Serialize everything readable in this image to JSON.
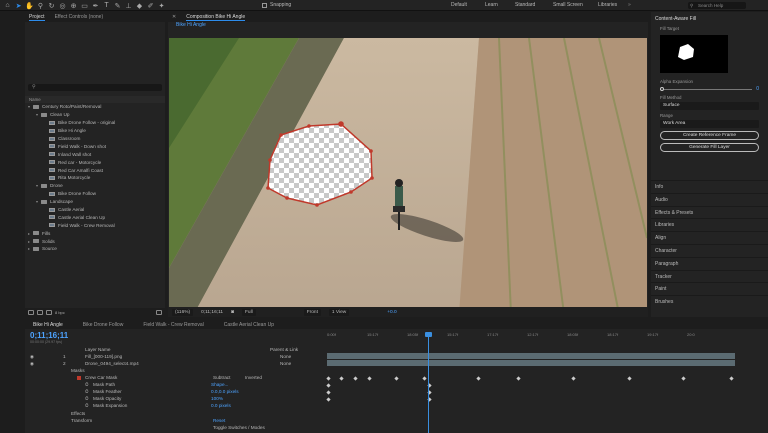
{
  "toolbar": {
    "snapping_label": "Snapping",
    "workspaces": [
      "Default",
      "Learn",
      "Standard",
      "Small Screen",
      "Libraries"
    ],
    "search_placeholder": "Search Help"
  },
  "project_panel": {
    "tabs": [
      "Project",
      "Effect Controls (none)"
    ],
    "column_header": "Name",
    "bpc": "8 bpc",
    "tree": [
      {
        "label": "Century Roto/Paint/Removal",
        "depth": 0,
        "kind": "folder",
        "open": true
      },
      {
        "label": "Clean Up",
        "depth": 1,
        "kind": "folder",
        "open": true
      },
      {
        "label": "Bike Drone Follow - original",
        "depth": 2,
        "kind": "comp"
      },
      {
        "label": "Bike Hi Angle",
        "depth": 2,
        "kind": "comp"
      },
      {
        "label": "Classroom",
        "depth": 2,
        "kind": "comp"
      },
      {
        "label": "Field Walk - Down shot",
        "depth": 2,
        "kind": "comp"
      },
      {
        "label": "Inland Wall shot",
        "depth": 2,
        "kind": "comp"
      },
      {
        "label": "Red car - Motorcycle",
        "depth": 2,
        "kind": "comp"
      },
      {
        "label": "Red Car Amalfi Coast",
        "depth": 2,
        "kind": "comp"
      },
      {
        "label": "Rita Motorcycle",
        "depth": 2,
        "kind": "comp"
      },
      {
        "label": "Drone",
        "depth": 1,
        "kind": "folder",
        "open": true
      },
      {
        "label": "Bike Drone Follow",
        "depth": 2,
        "kind": "comp"
      },
      {
        "label": "Landscape",
        "depth": 1,
        "kind": "folder",
        "open": true
      },
      {
        "label": "Castle Aerial",
        "depth": 2,
        "kind": "comp"
      },
      {
        "label": "Castle Aerial Clean Up",
        "depth": 2,
        "kind": "comp"
      },
      {
        "label": "Field Walk - Crew Removal",
        "depth": 2,
        "kind": "comp"
      },
      {
        "label": "Fills",
        "depth": 0,
        "kind": "folder",
        "open": false
      },
      {
        "label": "Solids",
        "depth": 0,
        "kind": "folder",
        "open": false
      },
      {
        "label": "Source",
        "depth": 0,
        "kind": "folder",
        "open": false
      }
    ]
  },
  "composition": {
    "tab_label": "Composition Bike Hi Angle",
    "sub_tab": "Bike Hi Angle",
    "footer": {
      "zoom": "(116%)",
      "timecode": "0;11;16;11",
      "resolution": "Full",
      "view": "Front",
      "views_count": "1 View",
      "exposure": "+0.0"
    }
  },
  "content_aware_fill": {
    "title": "Content-Aware Fill",
    "fill_target_label": "Fill Target",
    "alpha_expansion_label": "Alpha Expansion",
    "alpha_expansion_value": "0",
    "fill_method_label": "Fill Method",
    "fill_method_value": "Surface",
    "range_label": "Range",
    "range_value": "Work Area",
    "create_reference_frame": "Create Reference Frame",
    "generate_fill_layer": "Generate Fill Layer"
  },
  "right_panels": [
    "Info",
    "Audio",
    "Effects & Presets",
    "Libraries",
    "Align",
    "Character",
    "Paragraph",
    "Tracker",
    "Paint",
    "Brushes"
  ],
  "timeline": {
    "tabs": [
      "Bike Hi Angle",
      "Bike Drone Follow",
      "Field Walk - Crew Removal",
      "Castle Aerial Clean Up"
    ],
    "timecode": "0;11;16;11",
    "fps": "00:00:00 (29.97 fps)",
    "column_layer_name": "Layer Name",
    "column_parent": "Parent & Link",
    "ruler_ticks": [
      "0:00f",
      "15:17f",
      "18:05f",
      "15:17f",
      "17:17f",
      "12:17f",
      "18:05f",
      "18:17f",
      "19:17f",
      "20:0"
    ],
    "layers": [
      {
        "num": "1",
        "name": "Fill_[000-119].png",
        "parent": "None"
      },
      {
        "num": "2",
        "name": "Drone_0494_select4.mp4",
        "parent": "None"
      }
    ],
    "masks_label": "Masks",
    "mask_name": "Crew Car Mask",
    "mask_mode": "Subtract",
    "inverted_label": "Inverted",
    "mask_props": [
      {
        "name": "Mask Path",
        "value": "Shape..."
      },
      {
        "name": "Mask Feather",
        "value": "0.0,0.0 pixels"
      },
      {
        "name": "Mask Opacity",
        "value": "100%"
      },
      {
        "name": "Mask Expansion",
        "value": "0.0 pixels"
      }
    ],
    "effects_label": "Effects",
    "transform_label": "Transform",
    "reset_label": "Reset",
    "toggle_label": "Toggle Switches / Modes"
  },
  "colors": {
    "accent": "#2d8ceb",
    "mask_stroke": "#c0392b",
    "panel_bg": "#232323"
  }
}
